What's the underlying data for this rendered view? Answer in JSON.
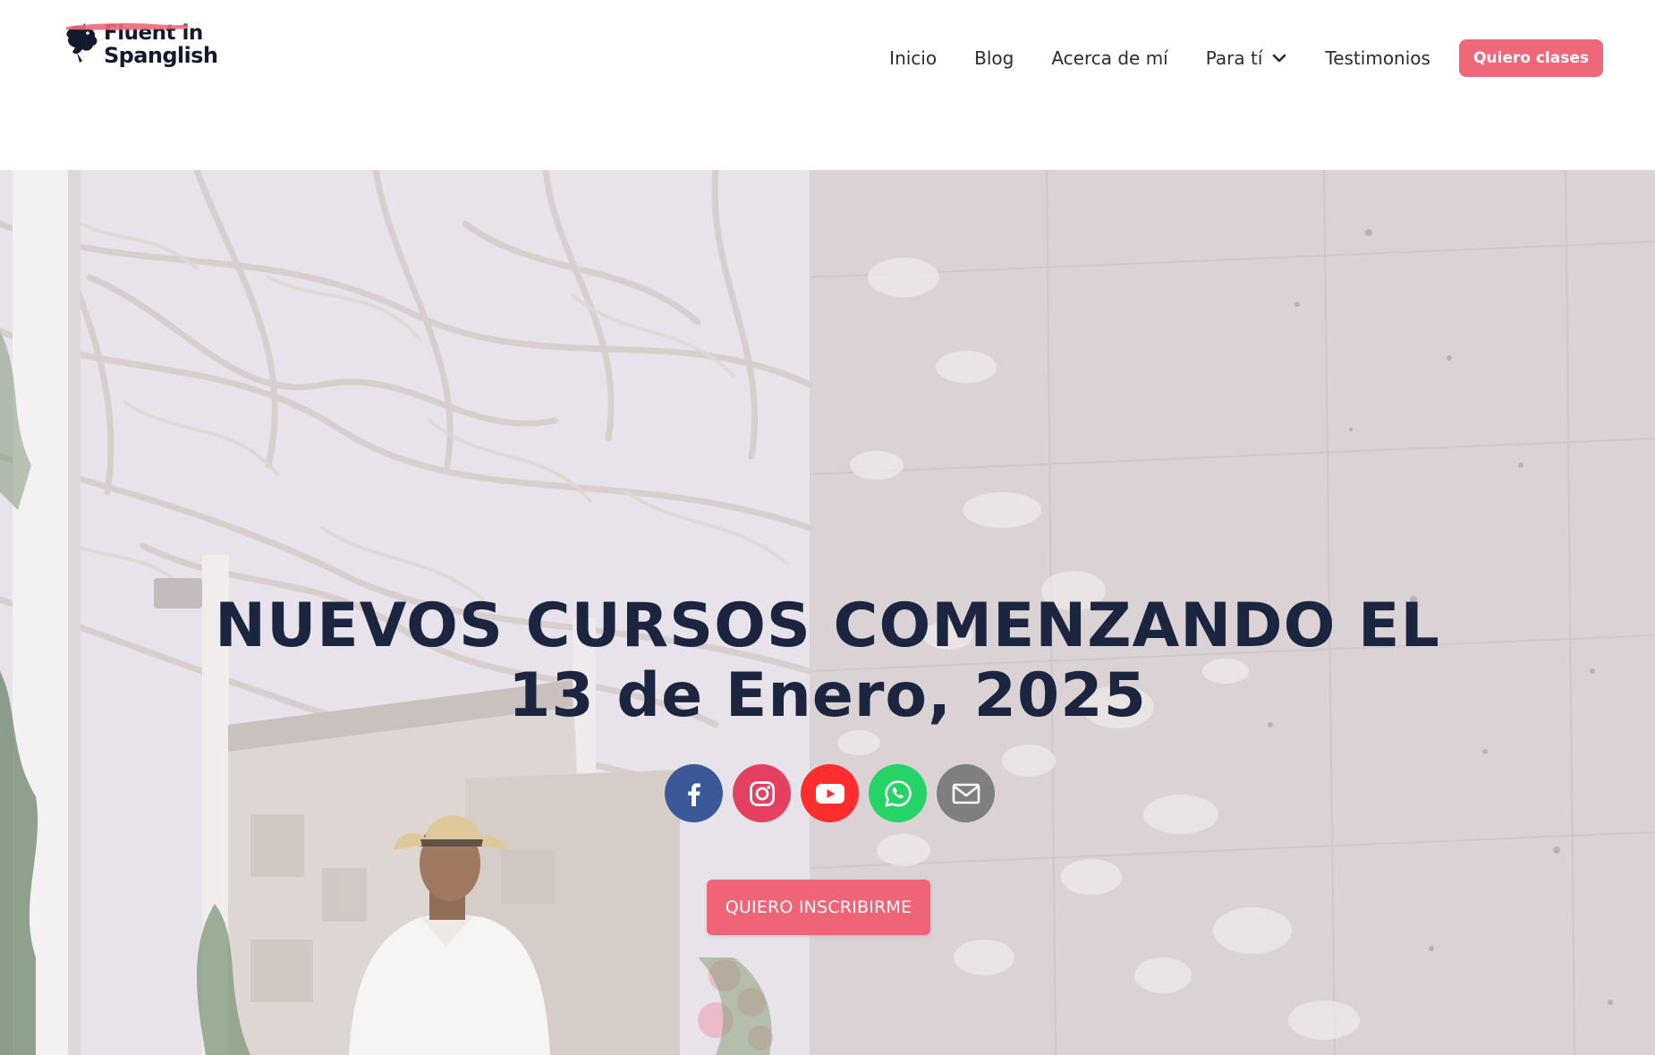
{
  "header": {
    "logo": {
      "line1": "Fluent in",
      "line2": "Spanglish"
    },
    "nav": [
      {
        "label": "Inicio"
      },
      {
        "label": "Blog"
      },
      {
        "label": "Acerca de mí"
      },
      {
        "label": "Para tí",
        "has_dropdown": true,
        "icon": "chevron-down-icon"
      },
      {
        "label": "Testimonios"
      }
    ],
    "cta_label": "Quiero clases"
  },
  "hero": {
    "title_line1": "NUEVOS CURSOS COMENZANDO EL",
    "title_line2": "13 de Enero, 2025",
    "social": [
      {
        "name": "facebook",
        "icon": "facebook-icon",
        "color": "#3b5998"
      },
      {
        "name": "instagram",
        "icon": "instagram-icon",
        "color": "#e4405f"
      },
      {
        "name": "youtube",
        "icon": "youtube-icon",
        "color": "#ff2d2d"
      },
      {
        "name": "whatsapp",
        "icon": "whatsapp-icon",
        "color": "#25d366"
      },
      {
        "name": "email",
        "icon": "mail-icon",
        "color": "#7f7f7f"
      }
    ],
    "cta_label": "QUIERO INSCRIBIRME"
  },
  "colors": {
    "accent": "#f06779",
    "heading": "#1b2540",
    "nav_text": "#2b2b33"
  }
}
